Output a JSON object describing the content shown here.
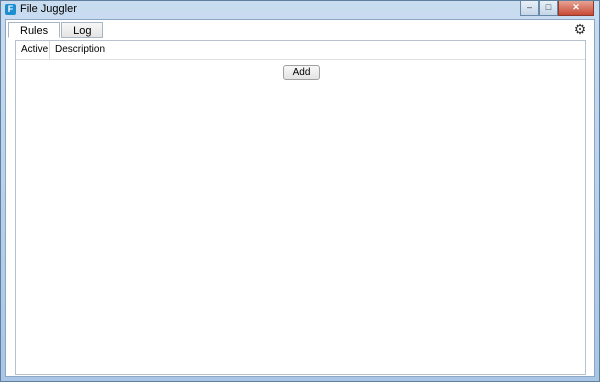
{
  "window": {
    "title": "File Juggler",
    "icon_letter": "F"
  },
  "caption": {
    "minimize": "–",
    "maximize": "□",
    "close": "✕"
  },
  "tabs": [
    {
      "label": "Rules"
    },
    {
      "label": "Log"
    }
  ],
  "settings": {
    "icon": "gear-icon",
    "glyph": "⚙"
  },
  "table": {
    "columns": [
      {
        "label": "Active"
      },
      {
        "label": "Description"
      }
    ]
  },
  "actions": {
    "add_label": "Add"
  }
}
